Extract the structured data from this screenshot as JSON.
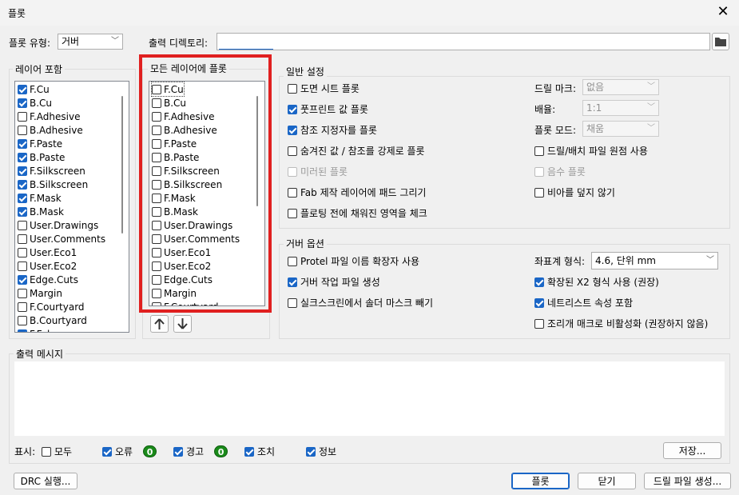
{
  "window": {
    "title": "플롯"
  },
  "top": {
    "plot_type_label": "플롯 유형:",
    "plot_type_value": "거버",
    "output_dir_label": "출력 디렉토리:",
    "output_dir_value": ""
  },
  "layers": {
    "title": "레이어 포함",
    "items": [
      {
        "label": "F.Cu",
        "checked": true
      },
      {
        "label": "B.Cu",
        "checked": true
      },
      {
        "label": "F.Adhesive",
        "checked": false
      },
      {
        "label": "B.Adhesive",
        "checked": false
      },
      {
        "label": "F.Paste",
        "checked": true
      },
      {
        "label": "B.Paste",
        "checked": true
      },
      {
        "label": "F.Silkscreen",
        "checked": true
      },
      {
        "label": "B.Silkscreen",
        "checked": true
      },
      {
        "label": "F.Mask",
        "checked": true
      },
      {
        "label": "B.Mask",
        "checked": true
      },
      {
        "label": "User.Drawings",
        "checked": false
      },
      {
        "label": "User.Comments",
        "checked": false
      },
      {
        "label": "User.Eco1",
        "checked": false
      },
      {
        "label": "User.Eco2",
        "checked": false
      },
      {
        "label": "Edge.Cuts",
        "checked": true
      },
      {
        "label": "Margin",
        "checked": false
      },
      {
        "label": "F.Courtyard",
        "checked": false
      },
      {
        "label": "B.Courtyard",
        "checked": false
      },
      {
        "label": "F.Fab",
        "checked": true
      }
    ]
  },
  "all_layers": {
    "title": "모든 레이어에 플롯",
    "items": [
      {
        "label": "F.Cu",
        "checked": false
      },
      {
        "label": "B.Cu",
        "checked": false
      },
      {
        "label": "F.Adhesive",
        "checked": false
      },
      {
        "label": "B.Adhesive",
        "checked": false
      },
      {
        "label": "F.Paste",
        "checked": false
      },
      {
        "label": "B.Paste",
        "checked": false
      },
      {
        "label": "F.Silkscreen",
        "checked": false
      },
      {
        "label": "B.Silkscreen",
        "checked": false
      },
      {
        "label": "F.Mask",
        "checked": false
      },
      {
        "label": "B.Mask",
        "checked": false
      },
      {
        "label": "User.Drawings",
        "checked": false
      },
      {
        "label": "User.Comments",
        "checked": false
      },
      {
        "label": "User.Eco1",
        "checked": false
      },
      {
        "label": "User.Eco2",
        "checked": false
      },
      {
        "label": "Edge.Cuts",
        "checked": false
      },
      {
        "label": "Margin",
        "checked": false
      },
      {
        "label": "F.Courtyard",
        "checked": false
      }
    ],
    "up_icon": "arrow-up-icon",
    "down_icon": "arrow-down-icon"
  },
  "general": {
    "title": "일반 설정",
    "left": [
      {
        "label": "도면 시트 플롯",
        "checked": false,
        "disabled": false
      },
      {
        "label": "풋프린트 값 플롯",
        "checked": true,
        "disabled": false
      },
      {
        "label": "참조 지정자를 플롯",
        "checked": true,
        "disabled": false
      },
      {
        "label": "숨겨진 값 / 참조를 강제로 플롯",
        "checked": false,
        "disabled": false
      },
      {
        "label": "미러된 플롯",
        "checked": false,
        "disabled": true
      },
      {
        "label": "Fab 제작 레이어에 패드 그리기",
        "checked": false,
        "disabled": false
      },
      {
        "label": "플로팅 전에 채워진 영역을 체크",
        "checked": false,
        "disabled": false
      }
    ],
    "drill_mark_label": "드릴 마크:",
    "drill_mark_value": "없음",
    "scale_label": "배율:",
    "scale_value": "1:1",
    "plot_mode_label": "플롯 모드:",
    "plot_mode_value": "채움",
    "right": [
      {
        "label": "드릴/배치 파일 원점 사용",
        "checked": false,
        "disabled": false
      },
      {
        "label": "음수 플롯",
        "checked": false,
        "disabled": true
      },
      {
        "label": "비아를 덮지 않기",
        "checked": false,
        "disabled": false
      }
    ]
  },
  "gerber": {
    "title": "거버 옵션",
    "left": [
      {
        "label": "Protel 파일 이름 확장자 사용",
        "checked": false
      },
      {
        "label": "거버 작업 파일 생성",
        "checked": true
      },
      {
        "label": "실크스크린에서 솔더 마스크 빼기",
        "checked": false
      }
    ],
    "coord_label": "좌표계 형식:",
    "coord_value": "4.6, 단위 mm",
    "right": [
      {
        "label": "확장된 X2 형식 사용 (권장)",
        "checked": true
      },
      {
        "label": "네트리스트 속성 포함",
        "checked": true
      },
      {
        "label": "조리개 매크로 비활성화 (권장하지 않음)",
        "checked": false
      }
    ]
  },
  "messages": {
    "title": "출력 메시지",
    "show_label": "표시:",
    "filters": [
      {
        "label": "모두",
        "checked": false
      },
      {
        "label": "오류",
        "checked": true,
        "count": "0"
      },
      {
        "label": "경고",
        "checked": true,
        "count": "0"
      },
      {
        "label": "조치",
        "checked": true
      },
      {
        "label": "정보",
        "checked": true
      }
    ],
    "save_label": "저장..."
  },
  "footer": {
    "drc_label": "DRC 실행...",
    "plot_label": "플롯",
    "close_label": "닫기",
    "drill_label": "드릴 파일 생성..."
  },
  "colors": {
    "accent": "#1a66c6",
    "highlight": "#e02020",
    "badge": "#1a8a1a"
  }
}
